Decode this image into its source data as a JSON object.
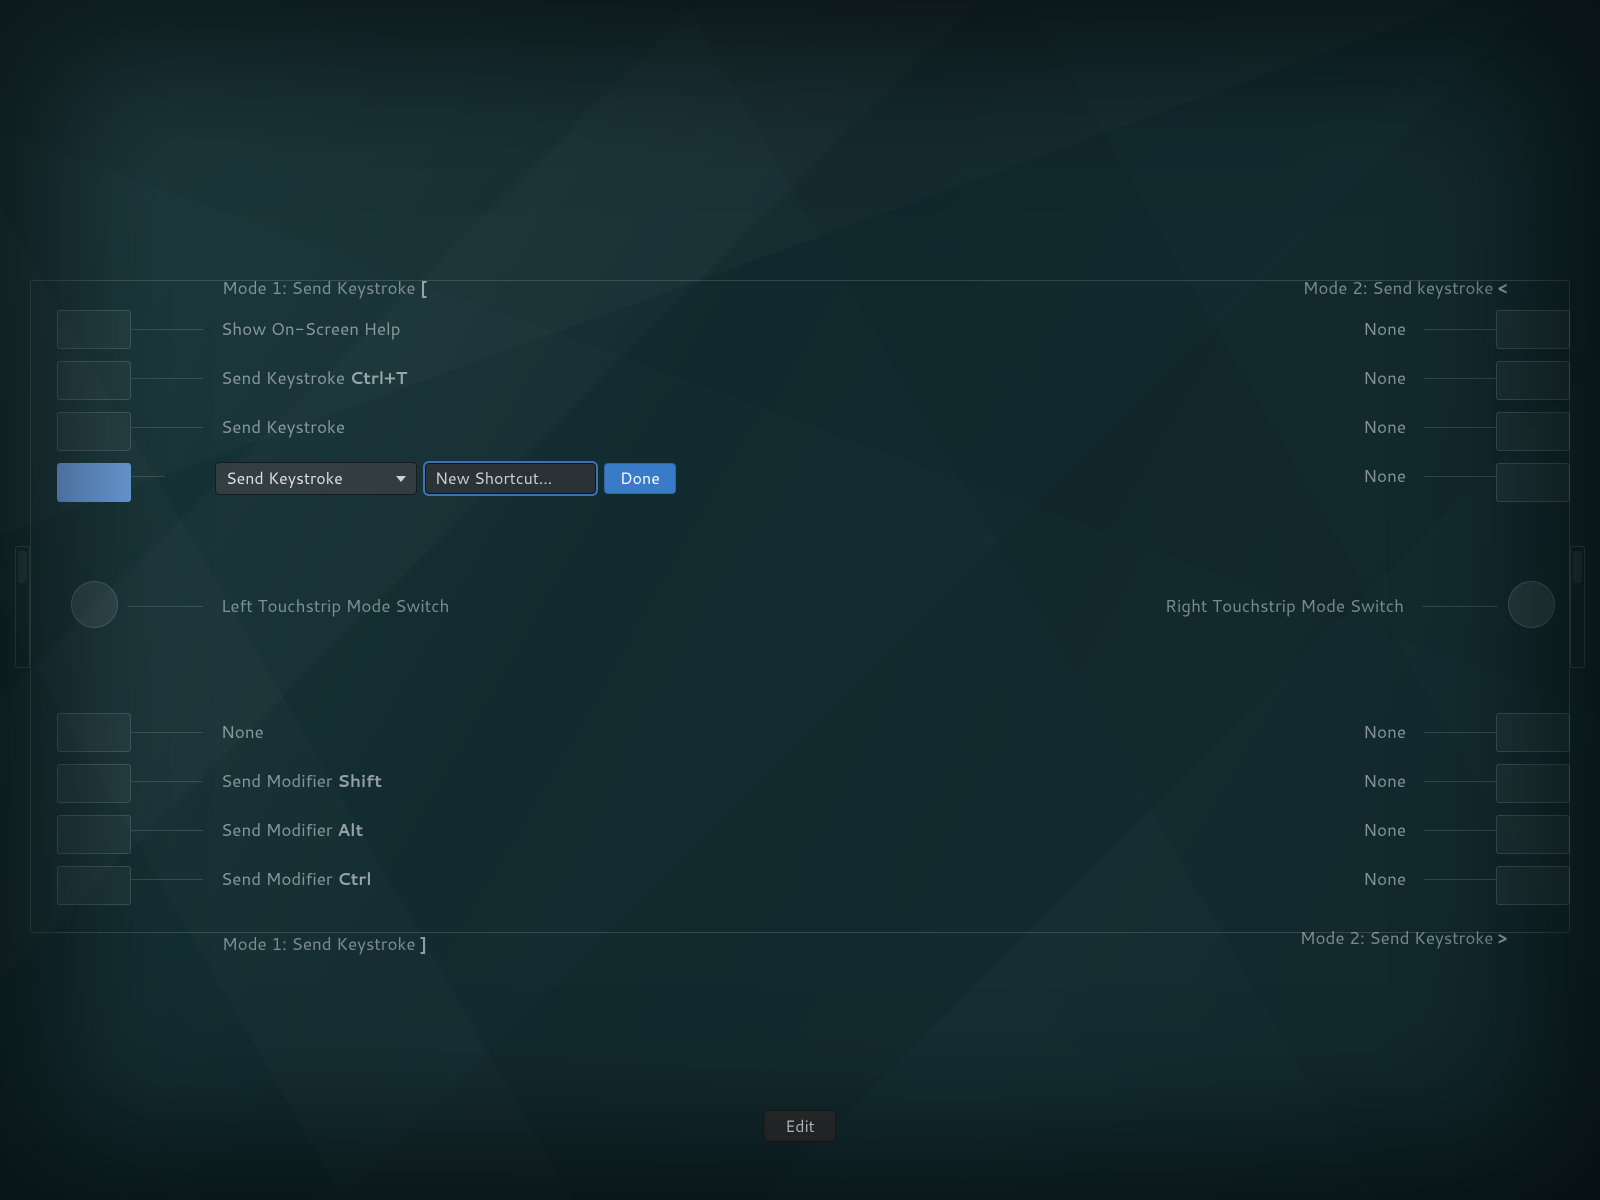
{
  "colors": {
    "accent": "#3a7bc8",
    "active_button": "#6a9bd8"
  },
  "mode_labels": {
    "top_left_prefix": "Mode 1: Send Keystroke ",
    "top_left_key": "[",
    "top_right_prefix": "Mode 2: Send keystroke ",
    "top_right_key": "<",
    "bot_left_prefix": "Mode 1: Send Keystroke ",
    "bot_left_key": "]",
    "bot_right_prefix": "Mode 2: Send Keystroke ",
    "bot_right_key": ">"
  },
  "left_upper": [
    {
      "text": "Show On-Screen Help",
      "bold": ""
    },
    {
      "text": "Send Keystroke ",
      "bold": "Ctrl+T"
    },
    {
      "text": "Send Keystroke",
      "bold": ""
    },
    {
      "text": "",
      "bold": ""
    }
  ],
  "right_upper": [
    "None",
    "None",
    "None",
    "None"
  ],
  "left_lower": [
    {
      "text": "None",
      "bold": ""
    },
    {
      "text": "Send Modifier ",
      "bold": "Shift"
    },
    {
      "text": "Send Modifier ",
      "bold": "Alt"
    },
    {
      "text": "Send Modifier ",
      "bold": "Ctrl"
    }
  ],
  "right_lower": [
    "None",
    "None",
    "None",
    "None"
  ],
  "touchstrip": {
    "left_label": "Left Touchstrip Mode Switch",
    "right_label": "Right Touchstrip Mode Switch"
  },
  "editor": {
    "action_selected": "Send Keystroke",
    "shortcut_placeholder": "New Shortcut…",
    "done_label": "Done"
  },
  "footer": {
    "edit_label": "Edit"
  }
}
